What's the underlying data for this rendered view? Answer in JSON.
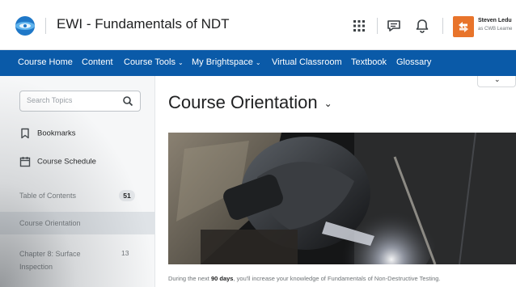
{
  "header": {
    "course_title": "EWI - Fundamentals of NDT",
    "user_name": "Steven Ledu",
    "user_role": "as CWB Learne"
  },
  "navbar": {
    "items": [
      {
        "label": "Course Home"
      },
      {
        "label": "Content"
      },
      {
        "label": "Course Tools",
        "has_menu": true
      },
      {
        "label": "My Brightspace",
        "has_menu": true
      },
      {
        "label": "Virtual Classroom"
      },
      {
        "label": "Textbook"
      },
      {
        "label": "Glossary"
      }
    ],
    "color": "#0a5aa8"
  },
  "sidebar": {
    "search_placeholder": "Search Topics",
    "bookmarks": "Bookmarks",
    "course_schedule": "Course Schedule",
    "toc_label": "Table of Contents",
    "toc_count": "51",
    "items": [
      {
        "label": "Course Orientation"
      },
      {
        "label": "Chapter 8: Surface Inspection",
        "count": "13"
      }
    ]
  },
  "main": {
    "page_title": "Course Orientation",
    "intro_prefix": "During the next ",
    "intro_bold": "90 days",
    "intro_suffix": ", you'll increase your knowledge of Fundamentals of Non-Destructive Testing."
  },
  "icons": {
    "logo": "globe-logo-icon",
    "apps": "waffle-grid-icon",
    "chat": "message-alerts-icon",
    "notifications": "bell-icon",
    "avatar_color": "#e8742b"
  }
}
